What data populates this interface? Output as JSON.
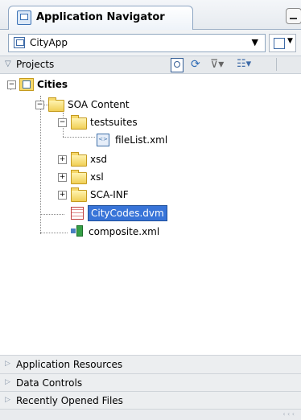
{
  "window": {
    "title": "Application Navigator"
  },
  "app_selector": {
    "value": "CityApp"
  },
  "projects_panel": {
    "label": "Projects"
  },
  "tree": {
    "project": "Cities",
    "soa_content": "SOA Content",
    "testsuites": "testsuites",
    "filelist": "fileList.xml",
    "xsd": "xsd",
    "xsl": "xsl",
    "sca_inf": "SCA-INF",
    "citycodes": "CityCodes.dvm",
    "composite": "composite.xml"
  },
  "accordions": {
    "app_resources": "Application Resources",
    "data_controls": "Data Controls",
    "recent_files": "Recently Opened Files"
  },
  "icons": [
    "app-navigator-icon",
    "application-icon",
    "search-icon",
    "sync-icon",
    "filter-icon",
    "layout-icon",
    "folder-icon",
    "xml-file-icon",
    "dvm-file-icon",
    "composite-icon",
    "expand-icon",
    "collapse-icon"
  ],
  "colors": {
    "selection": "#3874d8",
    "folder": "#f0cf55",
    "tab_border": "#8ea6c3"
  }
}
